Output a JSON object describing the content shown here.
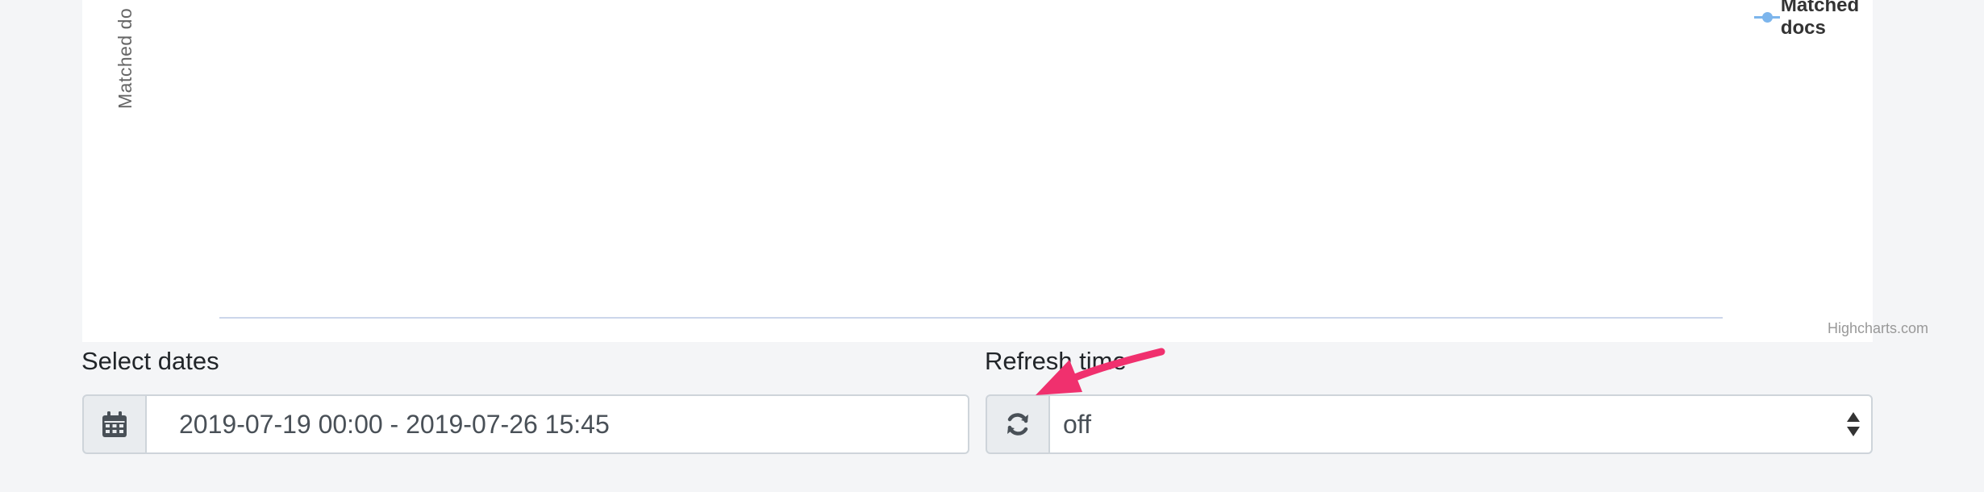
{
  "chart": {
    "y_axis_title": "Matched do",
    "legend_label": "Matched docs",
    "credits": "Highcharts.com"
  },
  "chart_data": {
    "type": "line",
    "ylabel": "Matched do",
    "legend_position": "top-right",
    "series": [
      {
        "name": "Matched docs",
        "values": []
      }
    ]
  },
  "form": {
    "dates_label": "Select dates",
    "dates_value": "2019-07-19 00:00 - 2019-07-26 15:45",
    "refresh_label": "Refresh time",
    "refresh_value": "off"
  },
  "icons": {
    "calendar": "calendar-icon",
    "refresh": "refresh-icon",
    "select_arrows": "select-arrows-icon",
    "annotation": "annotation-arrow"
  },
  "colors": {
    "series": "#7cb5ec",
    "annotation": "#f0306e",
    "axis_line": "#ccd6eb"
  }
}
